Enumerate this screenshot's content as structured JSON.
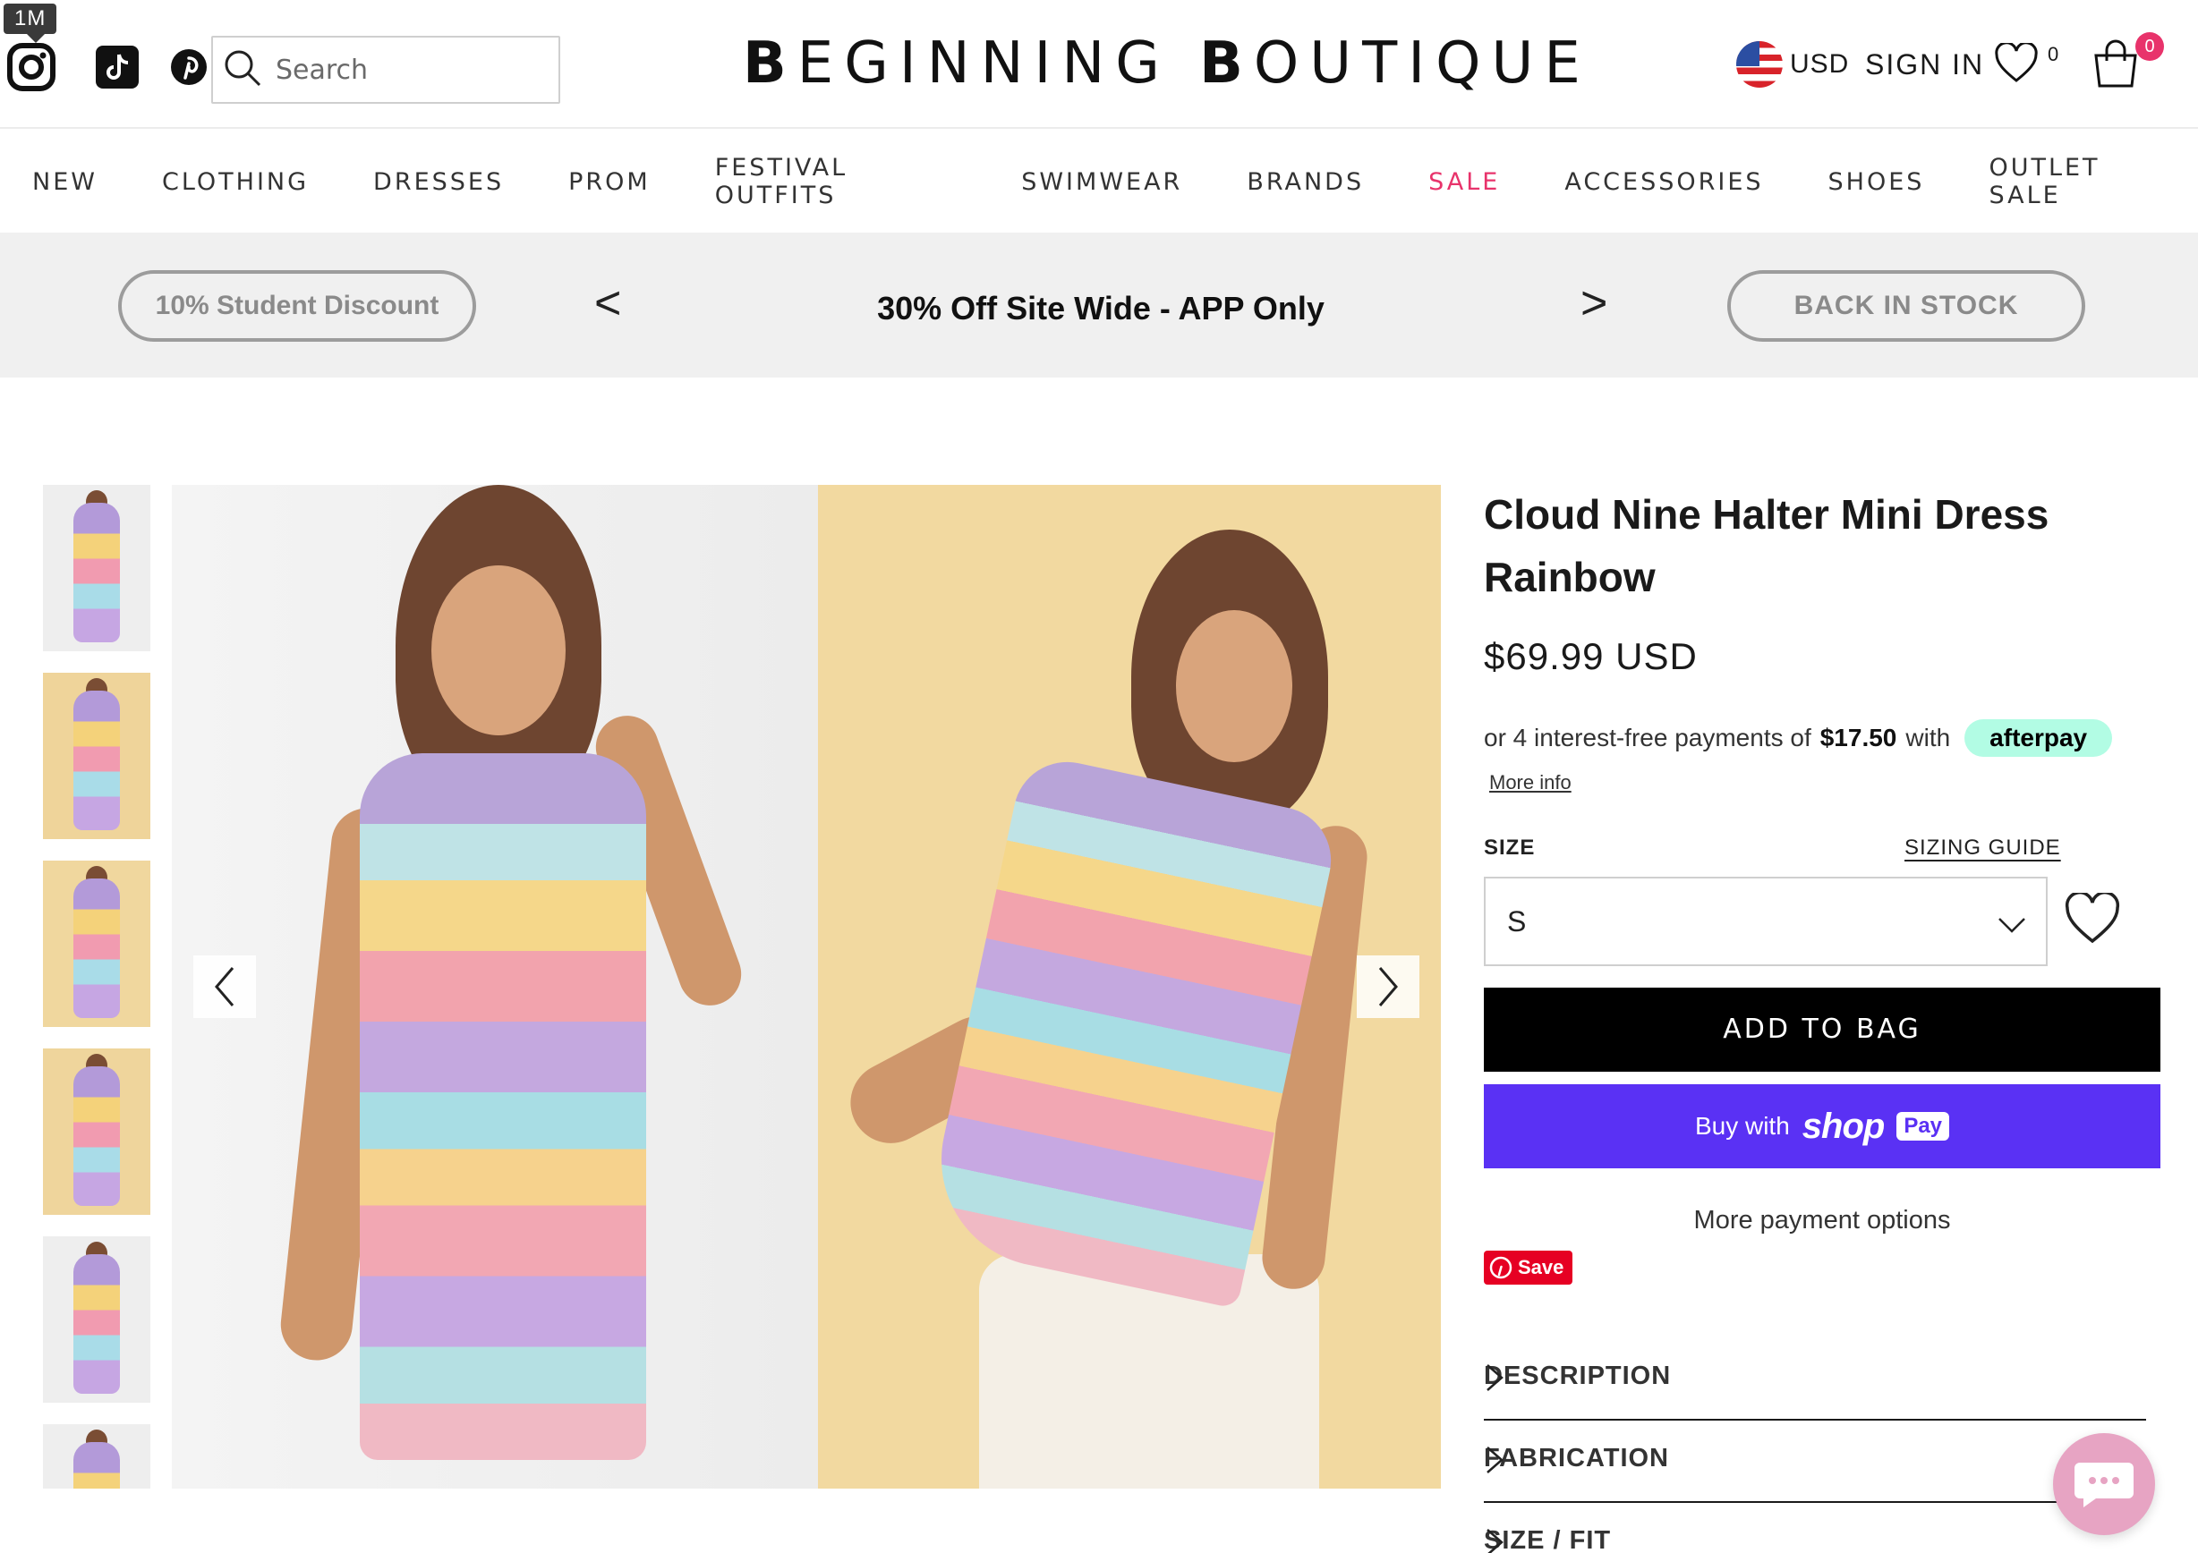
{
  "tooltip": {
    "label": "1M"
  },
  "header": {
    "search_placeholder": "Search",
    "logo_part1_bold": "B",
    "logo_part1": "EGINNING",
    "logo_part2_bold": "B",
    "logo_part2": "OUTIQUE",
    "currency": "USD",
    "sign_in": "SIGN IN",
    "wishlist_count": "0",
    "bag_count": "0"
  },
  "nav": {
    "items": [
      "NEW",
      "CLOTHING",
      "DRESSES",
      "PROM",
      "FESTIVAL OUTFITS",
      "SWIMWEAR",
      "BRANDS",
      "SALE",
      "ACCESSORIES",
      "SHOES",
      "OUTLET SALE"
    ]
  },
  "promo": {
    "left_pill": "10% Student Discount",
    "prev": "<",
    "message": "30% Off Site Wide - APP Only",
    "next": ">",
    "right_pill": "BACK IN STOCK"
  },
  "product": {
    "title": "Cloud Nine Halter Mini Dress Rainbow",
    "price": "$69.99 USD",
    "afterpay_prefix": "or 4 interest-free payments of",
    "afterpay_amount": "$17.50",
    "afterpay_with": "with",
    "afterpay_brand": "afterpay",
    "more_info": "More info",
    "size_label": "SIZE",
    "sizing_guide": "SIZING GUIDE",
    "size_selected": "S",
    "add_to_bag": "ADD TO BAG",
    "buy_with": "Buy with",
    "shop_word": "shop",
    "pay_word": "Pay",
    "more_payment": "More payment options",
    "pin_save": "Save",
    "accordions": [
      "DESCRIPTION",
      "FABRICATION",
      "SIZE / FIT"
    ]
  },
  "colors": {
    "accent_pink": "#e8336b",
    "shop_pay": "#5a31f4",
    "afterpay_mint": "#b2fce4",
    "pinterest_red": "#e60023"
  },
  "icons": {
    "social": [
      "instagram-icon",
      "tiktok-icon",
      "pinterest-icon"
    ],
    "search": "search-icon",
    "wishlist": "heart-icon",
    "bag": "shopping-bag-icon",
    "chat": "chat-icon"
  }
}
